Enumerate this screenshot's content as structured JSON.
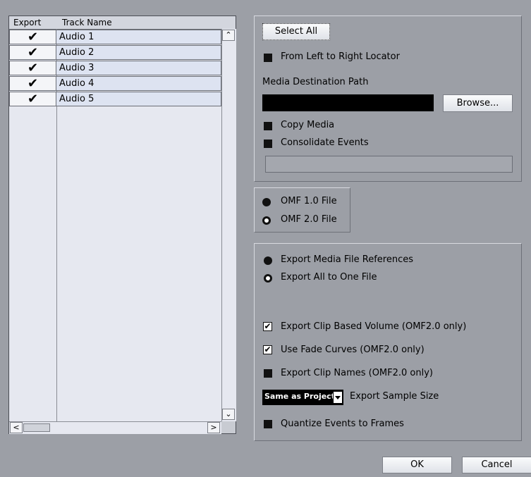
{
  "track_list": {
    "col_export": "Export",
    "col_track_name": "Track Name",
    "tracks": [
      {
        "checked": "✔",
        "name": "Audio 1"
      },
      {
        "checked": "✔",
        "name": "Audio 2"
      },
      {
        "checked": "✔",
        "name": "Audio 3"
      },
      {
        "checked": "✔",
        "name": "Audio 4"
      },
      {
        "checked": "✔",
        "name": "Audio 5"
      }
    ],
    "scroll_up": "⌃",
    "scroll_down": "⌄",
    "scroll_left": "<",
    "scroll_right": ">"
  },
  "selection": {
    "select_all": "Select All",
    "from_left_to_right": "From Left to Right Locator",
    "media_path_label": "Media Destination Path",
    "media_path_value": "",
    "browse": "Browse...",
    "copy_media": "Copy Media",
    "consolidate_events": "Consolidate Events"
  },
  "format": {
    "omf1": "OMF 1.0 File",
    "omf2": "OMF 2.0 File",
    "selected": "OMF 1.0 File"
  },
  "export_options": {
    "media_refs": "Export Media File References",
    "all_one_file": "Export All to One File",
    "clip_volume": "Export Clip Based Volume (OMF2.0 only)",
    "clip_volume_checked": true,
    "fade_curves": "Use Fade Curves (OMF2.0 only)",
    "fade_curves_checked": true,
    "clip_names": "Export Clip Names (OMF2.0 only)",
    "clip_names_checked": false,
    "sample_size_value": "Same as Project",
    "sample_size_label": "Export Sample Size",
    "quantize": "Quantize Events to Frames"
  },
  "footer": {
    "ok": "OK",
    "cancel": "Cancel"
  },
  "icons": {
    "check": "check-icon",
    "dropdown": "triangle-down-icon"
  }
}
